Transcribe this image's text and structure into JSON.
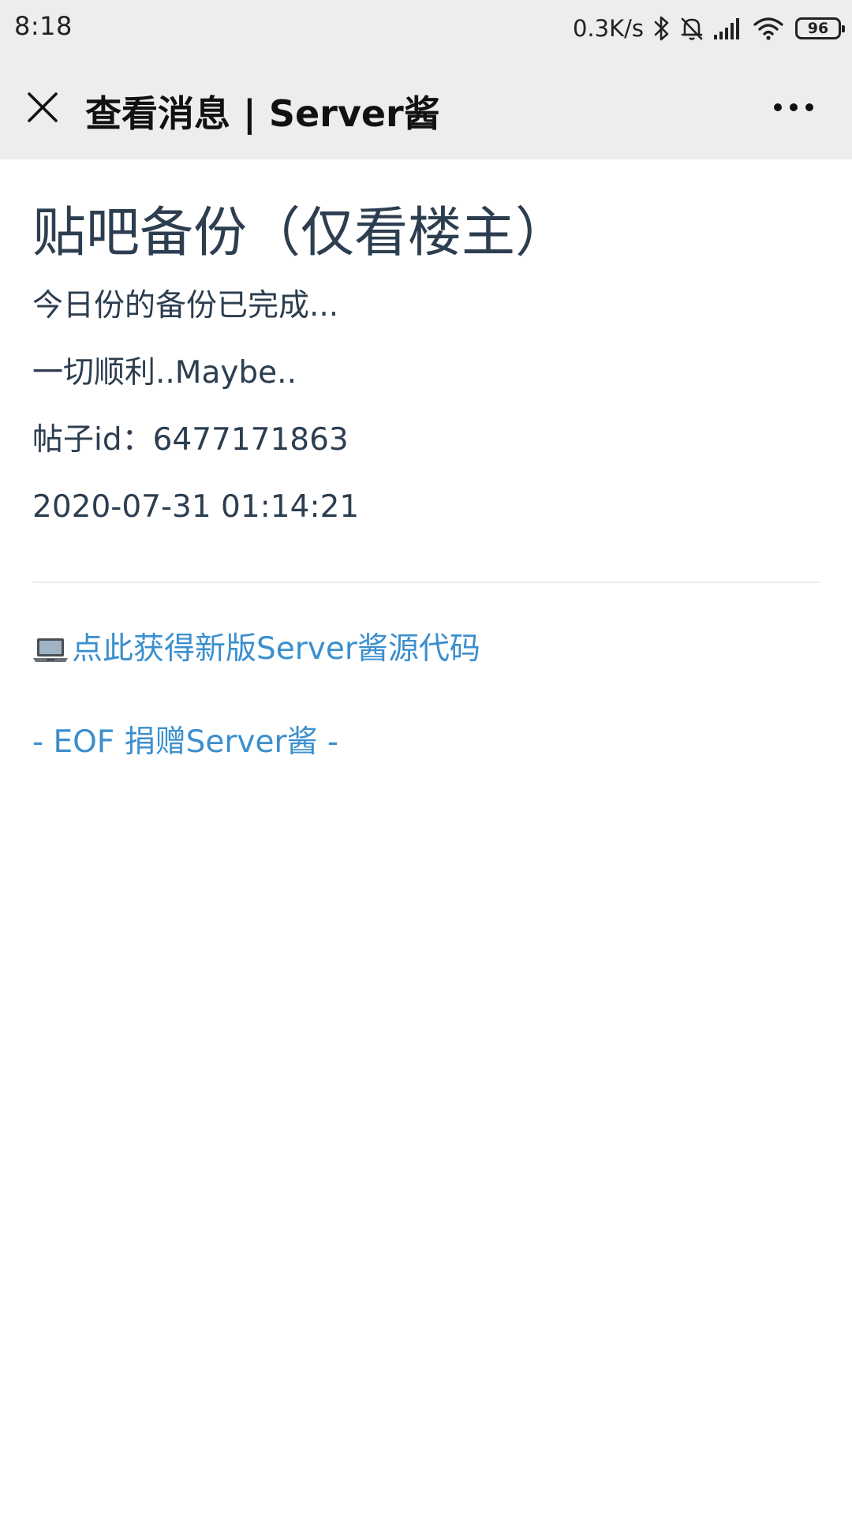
{
  "status_bar": {
    "time": "8:18",
    "net_speed": "0.3K/s",
    "battery": "96",
    "icons": [
      "bluetooth-icon",
      "mute-bell-icon",
      "signal-icon",
      "wifi-icon",
      "battery-icon"
    ]
  },
  "nav": {
    "title": "查看消息 | Server酱",
    "close_icon": "close-icon",
    "more_icon": "more-icon"
  },
  "message": {
    "title": "贴吧备份（仅看楼主）",
    "lines": [
      "今日份的备份已完成...",
      "一切顺利..Maybe..",
      "帖子id：6477171863",
      "2020-07-31 01:14:21"
    ]
  },
  "links": {
    "source_icon": "laptop-icon",
    "source_label": "点此获得新版Server酱源代码",
    "eof_label": "- EOF 捐赠Server酱 -"
  },
  "colors": {
    "header_bg": "#ededed",
    "text": "#2c3e50",
    "link": "#3b8fce",
    "divider": "#ececec"
  }
}
